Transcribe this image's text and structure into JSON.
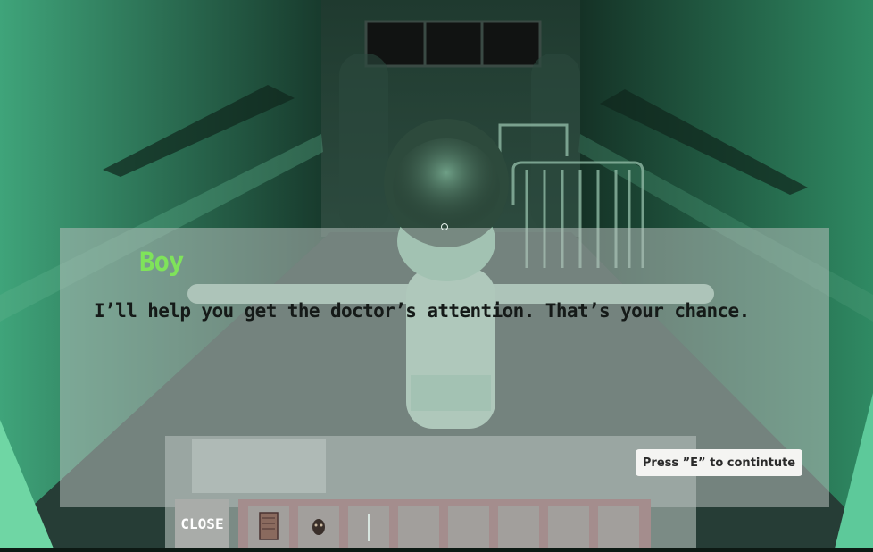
{
  "dialog": {
    "speaker": "Boy",
    "line": "I’ll help you get the doctor’s attention. That’s your chance.",
    "continue_hint": "Press ”E” to contintute"
  },
  "inventory": {
    "close_label": "CLOSE",
    "slots": [
      {
        "item": "note-icon"
      },
      {
        "item": "mask-icon"
      },
      {
        "item": "key-icon"
      },
      {
        "item": ""
      },
      {
        "item": ""
      },
      {
        "item": ""
      },
      {
        "item": ""
      },
      {
        "item": ""
      }
    ]
  },
  "colors": {
    "speaker": "#7fe35a",
    "dialog_text": "#151a18",
    "ambient": "#3c9a72"
  }
}
